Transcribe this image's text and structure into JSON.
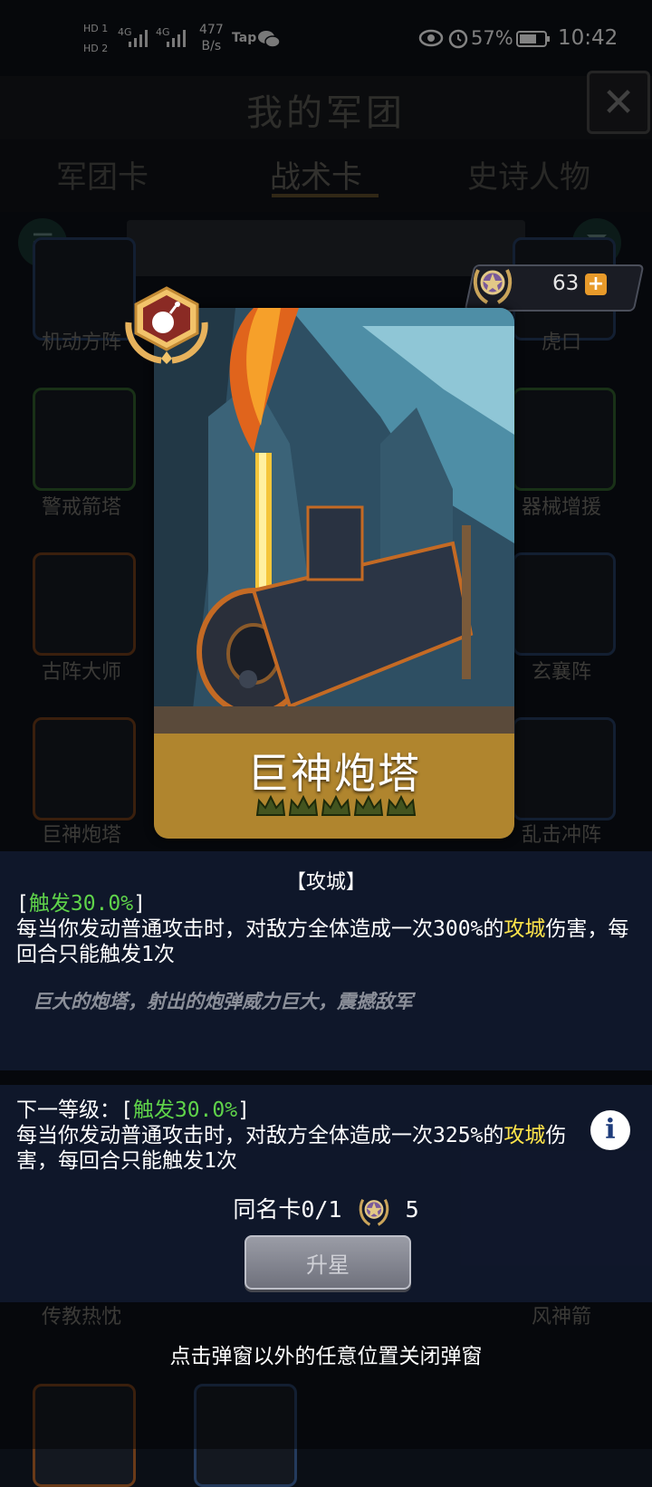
{
  "status_bar": {
    "hd1": "HD 1",
    "hd2": "HD 2",
    "signal1": "4G",
    "signal2": "4G",
    "net_speed_value": "477",
    "net_speed_unit": "B/s",
    "tap_label": "Tap",
    "battery": "57%",
    "time": "10:42"
  },
  "page": {
    "title": "我的军团",
    "tabs": [
      "军团卡",
      "战术卡",
      "史诗人物"
    ],
    "active_tab": 1
  },
  "grid": {
    "labels": [
      "机动方阵",
      "",
      "",
      "虎口",
      "警戒箭塔",
      "器械增援",
      "古阵大师",
      "玄襄阵",
      "巨神炮塔",
      "",
      "",
      "乱击冲阵",
      "",
      "",
      "",
      "传教热忱",
      "",
      "",
      "风神箭"
    ]
  },
  "card": {
    "name": "巨神炮塔",
    "stars": 5
  },
  "currency": {
    "amount": "63",
    "plus": "+"
  },
  "description": {
    "type_tag": "【攻城】",
    "trigger_open": "[",
    "trigger": "触发30.0%",
    "trigger_close": "]",
    "text_part1": "每当你发动普通攻击时，对敌方全体造成一次300%的",
    "keyword": "攻城",
    "text_part2": "伤害，每回合只能触发1次",
    "flavor": "巨大的炮塔，射出的炮弹威力巨大，震撼敌军"
  },
  "next_level": {
    "prefix": "下一等级：[",
    "trigger": "触发30.0%",
    "trigger_close": "]",
    "text_part1": "每当你发动普通攻击时，对敌方全体造成一次325%的",
    "keyword": "攻城",
    "text_part2": "伤害，每回合只能触发1次"
  },
  "same_card": {
    "label": "同名卡0/1",
    "count": "5"
  },
  "upgrade_button": "升星",
  "hint": "点击弹窗以外的任意位置关闭弹窗",
  "colors": {
    "trigger_green": "#5fd34a",
    "keyword_yellow": "#ffe54a",
    "card_band": "#b0852e",
    "panel_bg": "#101a2c"
  }
}
